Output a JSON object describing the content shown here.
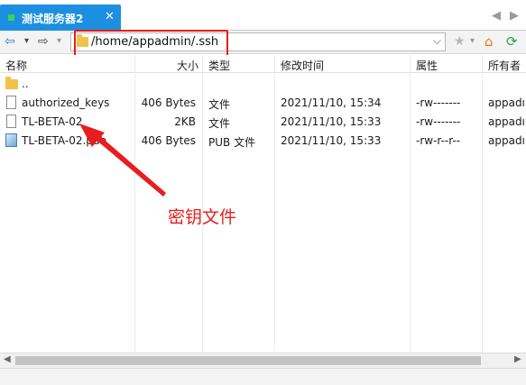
{
  "tab": {
    "title": "测试服务器2",
    "close": "✕"
  },
  "tab_nav": {
    "prev": "◀",
    "next": "▶"
  },
  "toolbar": {
    "back": "⇦",
    "dropdown": "▾",
    "forward": "⇨",
    "star": "★",
    "home": "⌂",
    "refresh": "⟳",
    "address_dropdown": "⌵"
  },
  "address": {
    "path": "/home/appadmin/.ssh"
  },
  "columns": {
    "name": "名称",
    "size": "大小",
    "type": "类型",
    "modified": "修改时间",
    "attributes": "属性",
    "owner": "所有者"
  },
  "files": [
    {
      "icon": "folder-icon",
      "name": "..",
      "size": "",
      "type": "",
      "modified": "",
      "attributes": "",
      "owner": ""
    },
    {
      "icon": "file-icon",
      "name": "authorized_keys",
      "size": "406 Bytes",
      "type": "文件",
      "modified": "2021/11/10, 15:34",
      "attributes": "-rw-------",
      "owner": "appadı"
    },
    {
      "icon": "file-icon",
      "name": "TL-BETA-02",
      "size": "2KB",
      "type": "文件",
      "modified": "2021/11/10, 15:33",
      "attributes": "-rw-------",
      "owner": "appadı"
    },
    {
      "icon": "pub-key-icon",
      "name": "TL-BETA-02.pub",
      "size": "406 Bytes",
      "type": "PUB 文件",
      "modified": "2021/11/10, 15:33",
      "attributes": "-rw-r--r--",
      "owner": "appadı"
    }
  ],
  "annotation": {
    "text": "密钥文件",
    "color": "#e81d1d"
  },
  "scrollbar": {
    "left": "◀",
    "right": "▶"
  },
  "colors": {
    "tab_accent": "#1c8fe0",
    "highlight": "#e81d1d",
    "connected": "#3ad25a"
  }
}
